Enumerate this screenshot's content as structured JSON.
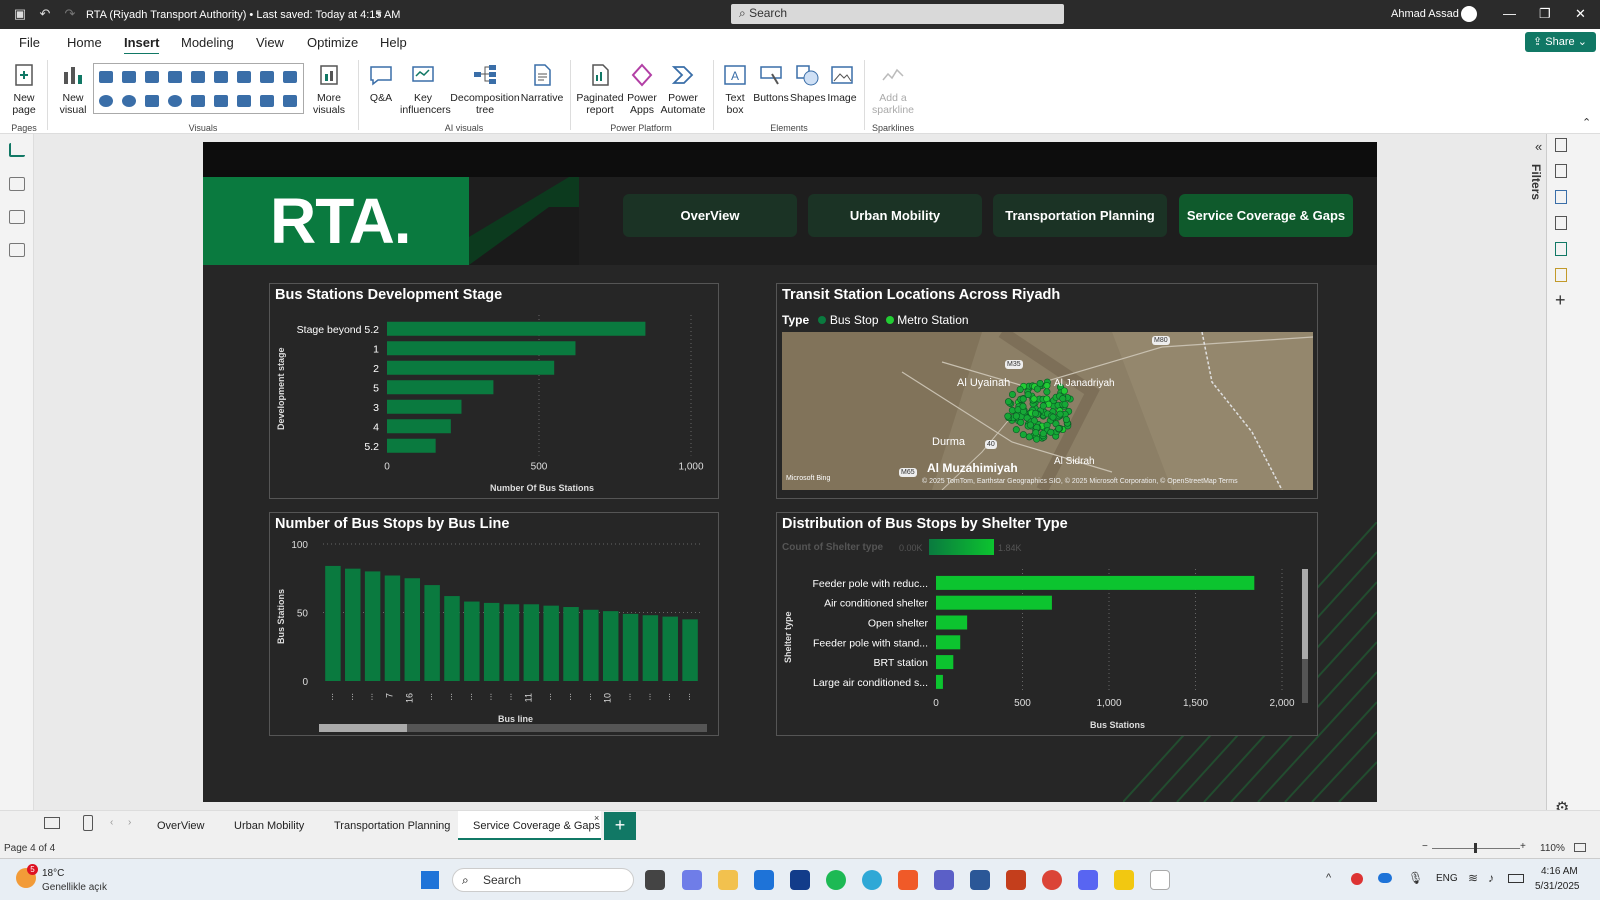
{
  "titlebar": {
    "doc_title": "RTA (Riyadh Transport Authority) • Last saved: Today at 4:15 AM",
    "search_placeholder": "Search",
    "user": "Ahmad Assad"
  },
  "menu": {
    "tabs": [
      "File",
      "Home",
      "Insert",
      "Modeling",
      "View",
      "Optimize",
      "Help"
    ],
    "active": "Insert",
    "share": "Share"
  },
  "ribbon": {
    "pages": {
      "new_page": "New page",
      "group": "Pages"
    },
    "visuals": {
      "new_visual": "New visual",
      "more_visuals": "More visuals",
      "group": "Visuals"
    },
    "ai": {
      "qa": "Q&A",
      "key_influencers": "Key influencers",
      "decomposition": "Decomposition tree",
      "narrative": "Narrative",
      "group": "AI visuals"
    },
    "power": {
      "paginated": "Paginated report",
      "power_apps": "Power Apps",
      "power_automate": "Power Automate",
      "group": "Power Platform"
    },
    "elements": {
      "text_box": "Text box",
      "buttons": "Buttons",
      "shapes": "Shapes",
      "image": "Image",
      "group": "Elements"
    },
    "sparklines": {
      "add": "Add a sparkline",
      "group": "Sparklines"
    }
  },
  "report": {
    "logo": "RTA.",
    "nav": [
      "OverView",
      "Urban Mobility",
      "Transportation Planning",
      "Service Coverage & Gaps"
    ],
    "active_nav": "Service Coverage & Gaps"
  },
  "chart_data": [
    {
      "id": "dev_stage",
      "type": "bar",
      "title": "Bus Stations Development Stage",
      "orientation": "horizontal",
      "categories": [
        "Stage beyond 5.2",
        "1",
        "2",
        "5",
        "3",
        "4",
        "5.2"
      ],
      "values": [
        850,
        620,
        550,
        350,
        245,
        210,
        160
      ],
      "xlabel": "Number Of Bus Stations",
      "ylabel": "Development stage",
      "xlim": [
        0,
        1000
      ],
      "xticks": [
        "0",
        "500",
        "1,000"
      ],
      "color": "#0a7a3f"
    },
    {
      "id": "bus_line",
      "type": "bar",
      "title": "Number of Bus Stops by Bus Line",
      "categories": [
        "...",
        "...",
        "...",
        "7",
        "16",
        "...",
        "...",
        "...",
        "...",
        "...",
        "11",
        "...",
        "...",
        "...",
        "10",
        "...",
        "...",
        "...",
        "..."
      ],
      "values": [
        84,
        82,
        80,
        77,
        75,
        70,
        62,
        58,
        57,
        56,
        56,
        55,
        54,
        52,
        51,
        49,
        48,
        47,
        45
      ],
      "xlabel": "Bus line",
      "ylabel": "Bus Stations",
      "ylim": [
        0,
        100
      ],
      "yticks": [
        "0",
        "50",
        "100"
      ],
      "color": "#0a7a3f"
    },
    {
      "id": "shelter",
      "type": "bar",
      "title": "Distribution of Bus Stops by Shelter Type",
      "orientation": "horizontal",
      "legend_title": "Count of Shelter type",
      "legend_min": "0.00K",
      "legend_max": "1.84K",
      "categories": [
        "Feeder pole with reduc...",
        "Air conditioned shelter",
        "Open shelter",
        "Feeder pole with stand...",
        "BRT station",
        "Large air conditioned s..."
      ],
      "values": [
        1840,
        670,
        180,
        140,
        100,
        40
      ],
      "xlabel": "Bus Stations",
      "ylabel": "Shelter type",
      "xlim": [
        0,
        2000
      ],
      "xticks": [
        "0",
        "500",
        "1,000",
        "1,500",
        "2,000"
      ],
      "color": "#0cc42f"
    }
  ],
  "map": {
    "title": "Transit Station Locations Across Riyadh",
    "legend_title": "Type",
    "legend": [
      {
        "name": "Bus Stop",
        "color": "#0a7a3f"
      },
      {
        "name": "Metro Station",
        "color": "#22cc33"
      }
    ],
    "places": [
      "Al Uyainah",
      "Al Janadriyah",
      "Durma",
      "Al Muzahimiyah",
      "Al Sidrah"
    ],
    "shields": [
      "M35",
      "M80",
      "40",
      "M65"
    ],
    "attribution": "© 2025 TomTom, Earthstar Geographics SIO, © 2025 Microsoft Corporation, © OpenStreetMap Terms",
    "bing": "Microsoft Bing"
  },
  "filters_label": "Filters",
  "page_tabs": [
    "OverView",
    "Urban Mobility",
    "Transportation Planning",
    "Service Coverage & Gaps"
  ],
  "status": {
    "page": "Page 4 of 4",
    "zoom": "110%"
  },
  "taskbar": {
    "temp": "18°C",
    "weather": "Genellikle açık",
    "search": "Search",
    "lang": "ENG",
    "time": "4:16 AM",
    "date": "5/31/2025",
    "badge": "5"
  }
}
